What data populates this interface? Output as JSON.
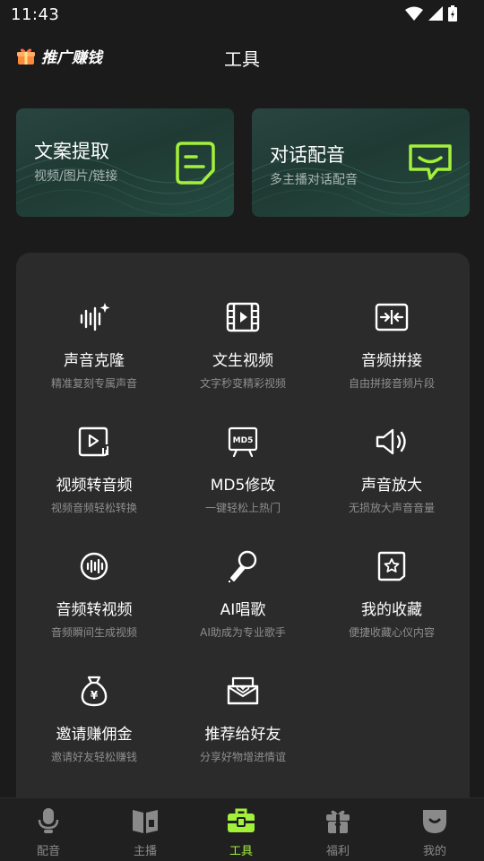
{
  "status": {
    "time": "11:43"
  },
  "header": {
    "promo_label": "推广赚钱",
    "title": "工具"
  },
  "cards": [
    {
      "title": "文案提取",
      "subtitle": "视频/图片/链接",
      "icon": "document-icon"
    },
    {
      "title": "对话配音",
      "subtitle": "多主播对话配音",
      "icon": "chat-icon"
    }
  ],
  "tools": [
    {
      "name": "声音克隆",
      "desc": "精准复刻专属声音",
      "icon": "voice-sparkle-icon"
    },
    {
      "name": "文生视频",
      "desc": "文字秒变精彩视频",
      "icon": "film-icon"
    },
    {
      "name": "音频拼接",
      "desc": "自由拼接音频片段",
      "icon": "merge-icon"
    },
    {
      "name": "视频转音频",
      "desc": "视频音频轻松转换",
      "icon": "video-play-icon"
    },
    {
      "name": "MD5修改",
      "desc": "一键轻松上热门",
      "icon": "md5-icon",
      "badge": "MD5"
    },
    {
      "name": "声音放大",
      "desc": "无损放大声音音量",
      "icon": "speaker-icon"
    },
    {
      "name": "音频转视频",
      "desc": "音频瞬间生成视频",
      "icon": "audio-circle-icon"
    },
    {
      "name": "AI唱歌",
      "desc": "AI助成为专业歌手",
      "icon": "microphone-icon"
    },
    {
      "name": "我的收藏",
      "desc": "便捷收藏心仪内容",
      "icon": "star-bookmark-icon"
    },
    {
      "name": "邀请赚佣金",
      "desc": "邀请好友轻松赚钱",
      "icon": "money-bag-icon",
      "badge": "¥"
    },
    {
      "name": "推荐给好友",
      "desc": "分享好物增进情谊",
      "icon": "heart-envelope-icon"
    }
  ],
  "tabs": [
    {
      "label": "配音",
      "icon": "mic-tab-icon",
      "active": false
    },
    {
      "label": "主播",
      "icon": "book-tab-icon",
      "active": false
    },
    {
      "label": "工具",
      "icon": "toolbox-tab-icon",
      "active": true
    },
    {
      "label": "福利",
      "icon": "gift-tab-icon",
      "active": false
    },
    {
      "label": "我的",
      "icon": "profile-tab-icon",
      "active": false
    }
  ],
  "colors": {
    "accent": "#a3f03a",
    "background": "#1b1b1b",
    "panel": "#2b2b2b",
    "inactive_tab": "#8a8a8a"
  }
}
